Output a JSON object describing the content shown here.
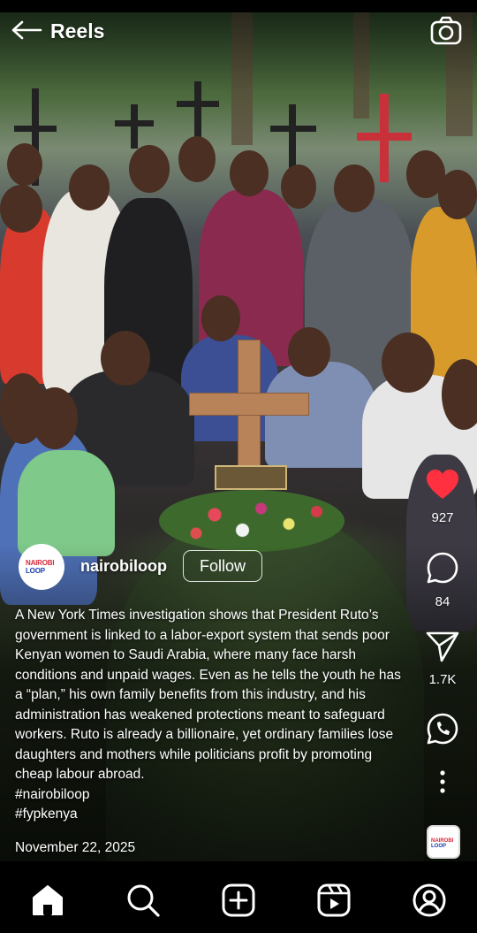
{
  "header": {
    "title": "Reels",
    "back_icon": "arrow-left-icon",
    "camera_icon": "camera-icon"
  },
  "account": {
    "avatar_text_line1": "NAIROBI",
    "avatar_text_line2": "LOOP",
    "username": "nairobiloop",
    "follow_label": "Follow"
  },
  "actions": {
    "likes": "927",
    "comments": "84",
    "shares": "1.7K"
  },
  "caption": {
    "text": "A New York Times investigation shows that President Ruto’s government is linked to a labor-export system that sends poor Kenyan women to Saudi Arabia, where many face harsh conditions and unpaid wages. Even as he tells the youth he has a “plan,” his own family benefits from this industry, and his administration has weakened protections meant to safeguard workers. Ruto is already a billionaire, yet ordinary families lose daughters and mothers while politicians profit by promoting cheap labour abroad.",
    "hashtags": [
      "#nairobiloop",
      "#fypkenya"
    ]
  },
  "date": "November 22, 2025",
  "nav": {
    "items": [
      "home-icon",
      "search-icon",
      "create-icon",
      "reels-icon",
      "profile-icon"
    ]
  },
  "colors": {
    "like_red": "#ff3040",
    "background": "#000000"
  }
}
